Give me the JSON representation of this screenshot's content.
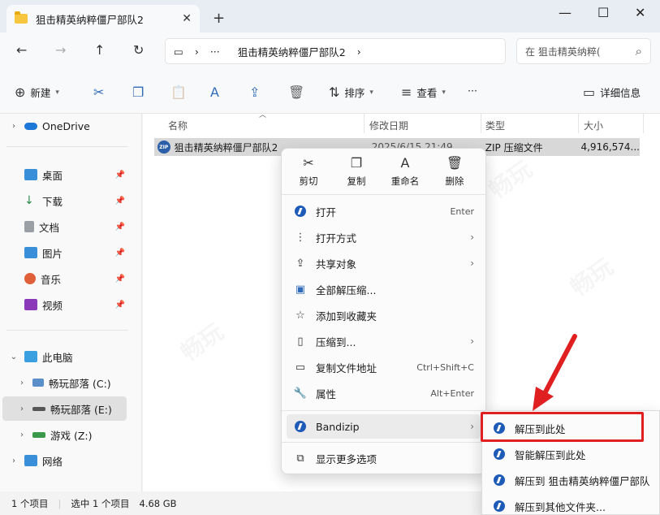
{
  "window": {
    "tab_title": "狙击精英纳粹僵尸部队2",
    "tab_close": "✕",
    "new_tab": "+",
    "minimize": "—",
    "maximize": "☐",
    "close": "✕"
  },
  "nav": {
    "back": "←",
    "forward": "→",
    "up": "↑",
    "refresh": "↻",
    "address_computer_icon": "▭",
    "address_chevron1": "›",
    "address_more": "···",
    "address_path": "狙击精英纳粹僵尸部队2",
    "address_chevron2": "›",
    "search_placeholder": "在 狙击精英纳粹(",
    "search_icon": "⌕"
  },
  "toolbar": {
    "new_label": "新建",
    "cut_icon": "✂",
    "copy_icon": "❐",
    "paste_icon": "📋",
    "rename_icon": "A",
    "share_icon": "⇪",
    "delete_icon": "🗑",
    "sort_label": "排序",
    "view_label": "查看",
    "more": "···",
    "details_label": "详细信息"
  },
  "sidebar": {
    "onedrive": "OneDrive",
    "quick": [
      {
        "label": "桌面",
        "color": "#3a8fd9"
      },
      {
        "label": "下载",
        "color": "#2a8a4a"
      },
      {
        "label": "文档",
        "color": "#8a8a8a"
      },
      {
        "label": "图片",
        "color": "#3a8fd9"
      },
      {
        "label": "音乐",
        "color": "#e0603a"
      },
      {
        "label": "视频",
        "color": "#8a3ab9"
      }
    ],
    "this_pc": "此电脑",
    "drives": [
      {
        "label": "畅玩部落 (C:)"
      },
      {
        "label": "畅玩部落 (E:)"
      },
      {
        "label": "游戏 (Z:)"
      }
    ],
    "network": "网络"
  },
  "columns": {
    "name": "名称",
    "modified": "修改日期",
    "type": "类型",
    "size": "大小"
  },
  "file": {
    "name": "狙击精英纳粹僵尸部队2",
    "modified": "2025/6/15 21:49",
    "type": "ZIP 压缩文件",
    "size": "4,916,574..."
  },
  "status": {
    "count": "1 个项目",
    "selected": "选中 1 个项目",
    "size": "4.68 GB"
  },
  "context_menu": {
    "quick": [
      {
        "icon": "✂",
        "label": "剪切"
      },
      {
        "icon": "❐",
        "label": "复制"
      },
      {
        "icon": "A",
        "label": "重命名"
      },
      {
        "icon": "🗑",
        "label": "删除"
      }
    ],
    "items": [
      {
        "label": "打开",
        "shortcut": "Enter",
        "arrow": ""
      },
      {
        "label": "打开方式",
        "shortcut": "",
        "arrow": "›"
      },
      {
        "label": "共享对象",
        "shortcut": "",
        "arrow": "›"
      },
      {
        "label": "全部解压缩...",
        "shortcut": "",
        "arrow": ""
      },
      {
        "label": "添加到收藏夹",
        "shortcut": "",
        "arrow": ""
      },
      {
        "label": "压缩到...",
        "shortcut": "",
        "arrow": "›"
      },
      {
        "label": "复制文件地址",
        "shortcut": "Ctrl+Shift+C",
        "arrow": ""
      },
      {
        "label": "属性",
        "shortcut": "Alt+Enter",
        "arrow": ""
      }
    ],
    "bandizip": "Bandizip",
    "bandizip_arrow": "›",
    "more_options": "显示更多选项"
  },
  "submenu": {
    "items": [
      "解压到此处",
      "智能解压到此处",
      "解压到 狙击精英纳粹僵尸部队",
      "解压到其他文件夹..."
    ]
  },
  "colors": {
    "accent": "#2f6bb8",
    "highlight": "#e02020"
  }
}
